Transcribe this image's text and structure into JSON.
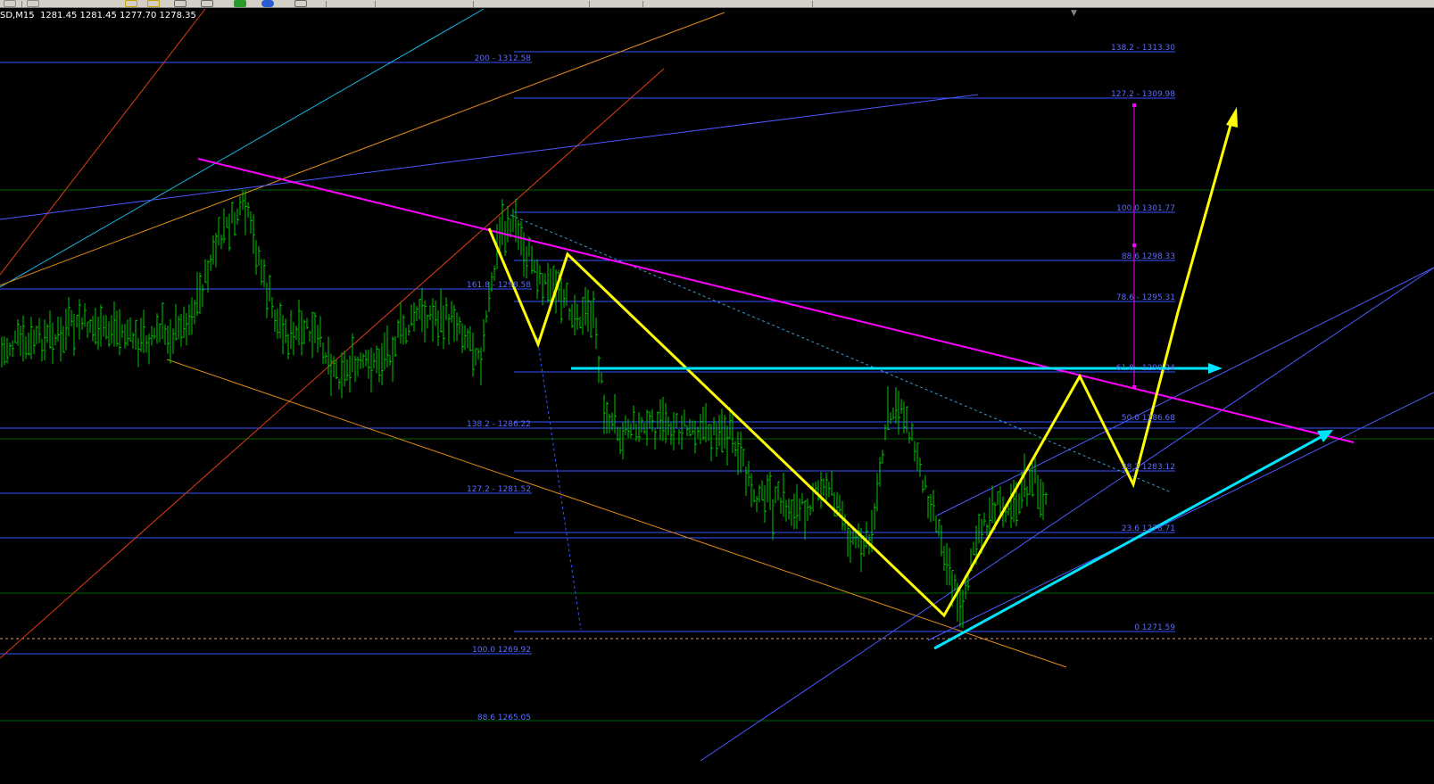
{
  "chart_header": {
    "symbol_timeframe": "SD,M15",
    "ohlc": "1281.45 1281.45 1277.70 1278.35"
  },
  "fib_levels_right": [
    "138.2 - 1313.30",
    "127.2 - 1309.98",
    "100.0 1301.77",
    "88.6 1298.33",
    "78.6 - 1295.31",
    "61.8 - 1290.24",
    "50.0 1286.68",
    "38.2 1283.12",
    "23.6 1278.71",
    "0 1271.59"
  ],
  "fib_levels_left": [
    "200 - 1312.58",
    "161.8 - 1298.58",
    "138.2 - 1286.22",
    "127.2 - 1281.52",
    "100.0 1269.92",
    "88.6 1265.05"
  ],
  "colors": {
    "background": "#000000",
    "candles": "#00c800",
    "fib_lines": "#3355ff",
    "fib_text": "#5a6cff",
    "trend_magenta": "#ff00ff",
    "zigzag": "#ffff00",
    "arrow_cyan": "#00e5ff",
    "channel_orange": "#e08a1a",
    "channel_red": "#e03c14",
    "channel_cyan": "#1ab4e6",
    "green_hline": "#006400"
  },
  "icons": {
    "toolbar": [
      "cursor-icon",
      "crosshair-icon",
      "zoom-in-icon",
      "zoom-out-icon",
      "add-icon",
      "indicator-icon",
      "period-icon"
    ]
  }
}
